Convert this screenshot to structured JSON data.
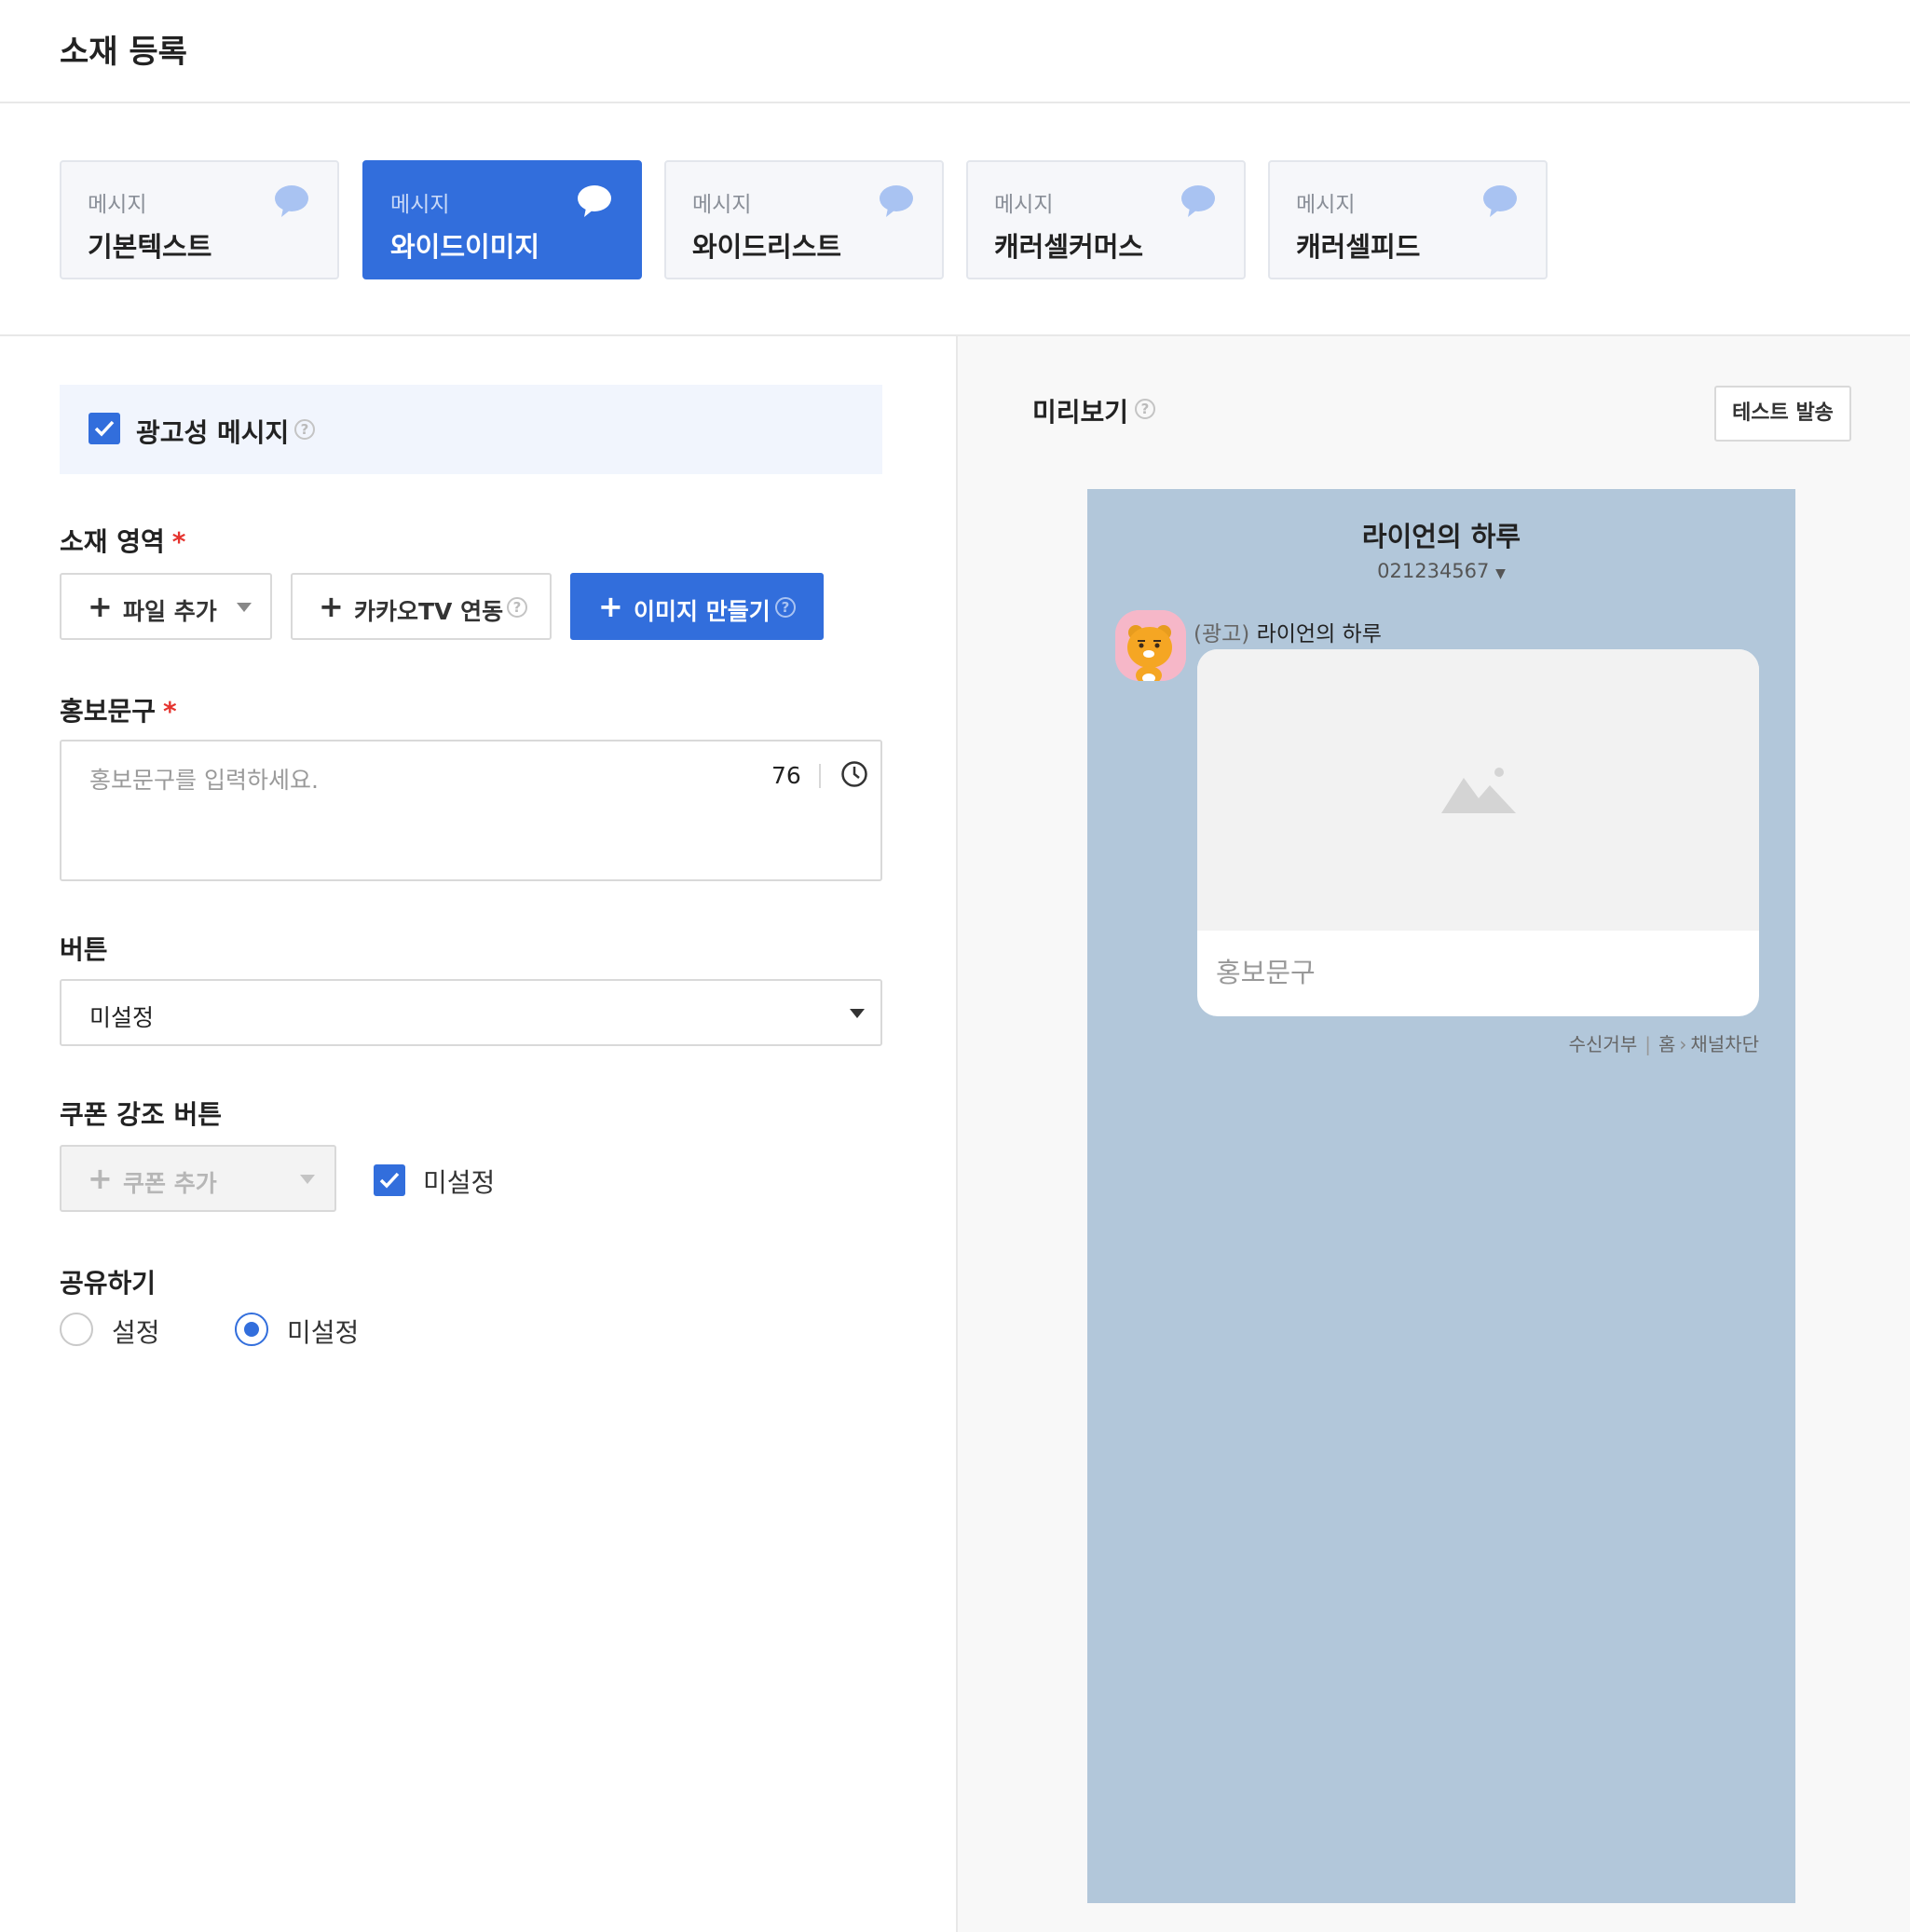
{
  "page": {
    "title": "소재 등록"
  },
  "message_types": [
    {
      "category": "메시지",
      "name": "기본텍스트",
      "active": false
    },
    {
      "category": "메시지",
      "name": "와이드이미지",
      "active": true
    },
    {
      "category": "메시지",
      "name": "와이드리스트",
      "active": false
    },
    {
      "category": "메시지",
      "name": "캐러셀커머스",
      "active": false
    },
    {
      "category": "메시지",
      "name": "캐러셀피드",
      "active": false
    }
  ],
  "form": {
    "ad_message": {
      "label": "광고성 메시지",
      "checked": true
    },
    "material_area": {
      "label": "소재 영역",
      "add_file": "파일 추가",
      "kakaotv": "카카오TV 연동",
      "make_image": "이미지 만들기"
    },
    "promo": {
      "label": "홍보문구",
      "placeholder": "홍보문구를 입력하세요.",
      "remaining": "76"
    },
    "button": {
      "label": "버튼",
      "value": "미설정"
    },
    "coupon": {
      "label": "쿠폰 강조 버튼",
      "add": "쿠폰 추가",
      "unset_label": "미설정",
      "unset_checked": true
    },
    "share": {
      "label": "공유하기",
      "options": [
        "설정",
        "미설정"
      ],
      "selected": "미설정"
    },
    "required_mark": "*"
  },
  "preview": {
    "title": "미리보기",
    "test_send": "테스트 발송",
    "channel_name": "라이언의 하루",
    "channel_number": "021234567",
    "ad_tag": "(광고)",
    "sender": "라이언의 하루",
    "bubble_text": "홍보문구",
    "footer": {
      "reject": "수신거부",
      "home": "홈",
      "block": "채널차단"
    }
  },
  "colors": {
    "primary": "#326edc",
    "preview_bg": "#b2c7da",
    "required": "#e5332e"
  }
}
